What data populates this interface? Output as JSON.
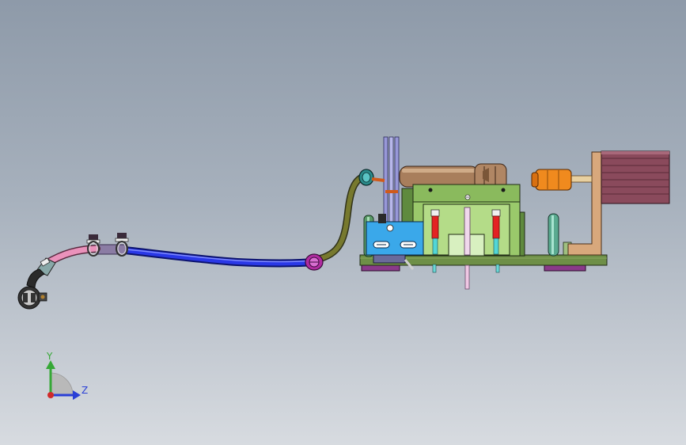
{
  "triad": {
    "y_label": "Y",
    "z_label": "Z"
  },
  "colors": {
    "background_top": "#8e9aa9",
    "background_bottom": "#d7dbe0",
    "base_plate": "#6e8f47",
    "frame": "#9ac96b",
    "blue_hose": "#2230d8",
    "pink_hose": "#e68fb8",
    "olive_hose": "#6b6e2a",
    "motor": "#8a4a5c",
    "orange_coupler": "#f08a1e",
    "bracket": "#d8a87c",
    "cylinder": "#a87e5c",
    "red_pin": "#e32222",
    "fixture_block": "#38a8e8",
    "axis_y": "#36a836",
    "axis_z": "#2a3fd6",
    "axis_x": "#d02a2a"
  }
}
